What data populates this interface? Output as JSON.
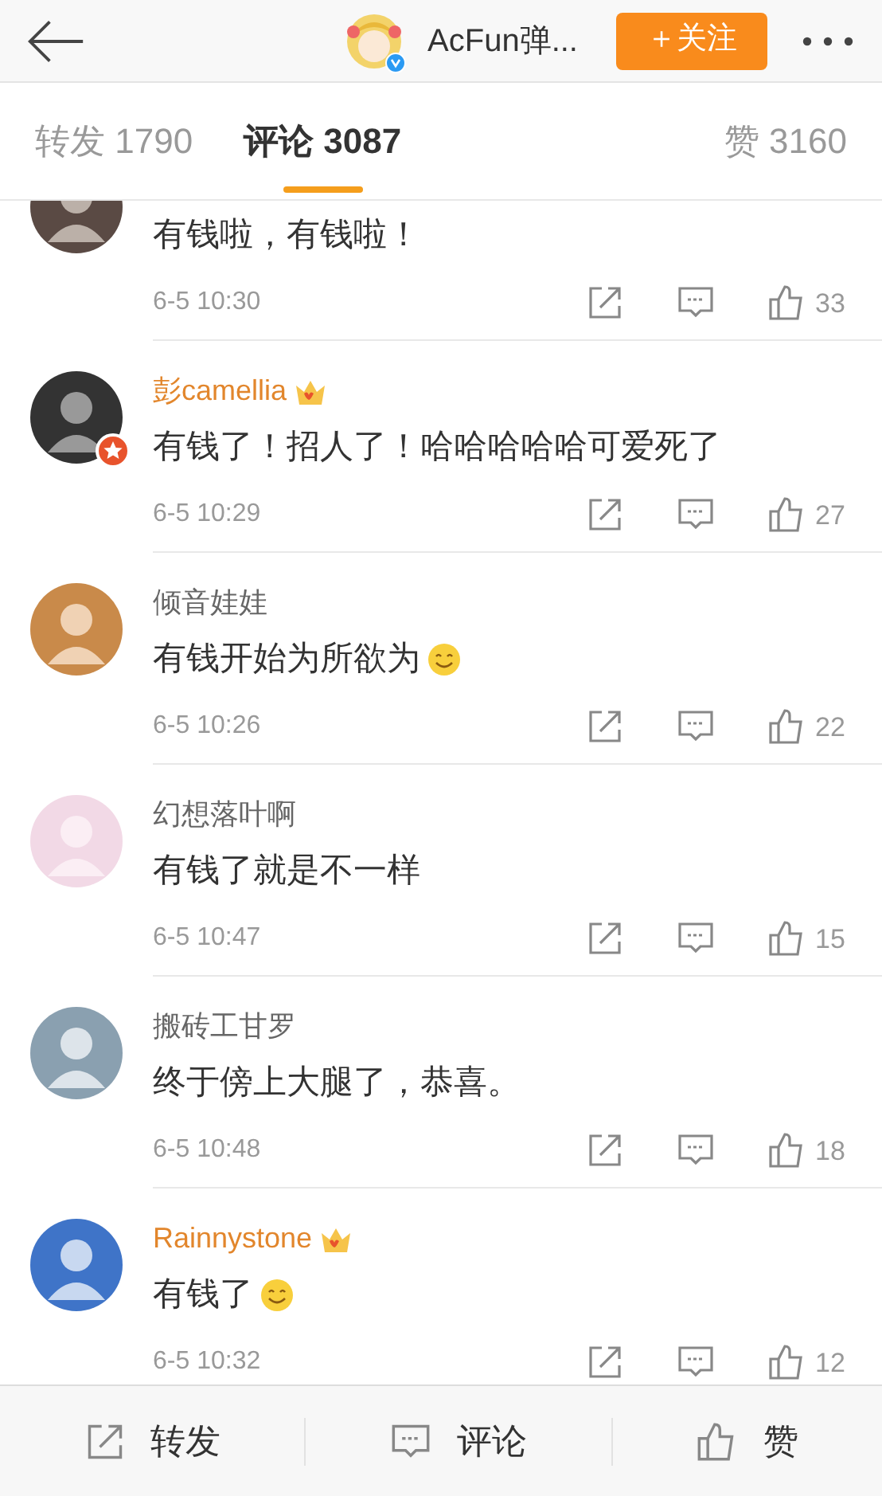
{
  "header": {
    "title": "AcFun弹...",
    "verified": true,
    "follow_button": "＋关注"
  },
  "tabs": [
    {
      "label": "转发 1790",
      "selected": false
    },
    {
      "label": "评论 3087",
      "selected": true
    },
    {
      "label": "赞 3160",
      "selected": false
    }
  ],
  "comments": [
    {
      "text": "有钱啦，有钱啦！",
      "time": "6-5 10:30",
      "likes": "33",
      "badge": false,
      "emoji": false
    },
    {
      "name": "彭camellia",
      "text": "有钱了！招人了！哈哈哈哈哈可爱死了",
      "time": "6-5 10:29",
      "likes": "27",
      "vip": true,
      "badge": true,
      "emoji": false
    },
    {
      "name": "倾音娃娃",
      "text": "有钱开始为所欲为",
      "time": "6-5 10:26",
      "likes": "22",
      "vip": false,
      "badge": false,
      "emoji": true
    },
    {
      "name": "幻想落叶啊",
      "text": "有钱了就是不一样",
      "time": "6-5 10:47",
      "likes": "15",
      "vip": false,
      "badge": false,
      "emoji": false
    },
    {
      "name": "搬砖工甘罗",
      "text": "终于傍上大腿了，恭喜。",
      "time": "6-5 10:48",
      "likes": "18",
      "vip": false,
      "badge": false,
      "emoji": false
    },
    {
      "name": "Rainnystone",
      "text": "有钱了",
      "time": "6-5 10:32",
      "likes": "12",
      "vip": true,
      "badge": false,
      "emoji": true
    }
  ],
  "bottom_bar": [
    {
      "kind": "share",
      "label": "转发"
    },
    {
      "kind": "comment",
      "label": "评论"
    },
    {
      "kind": "like",
      "label": "赞"
    }
  ]
}
